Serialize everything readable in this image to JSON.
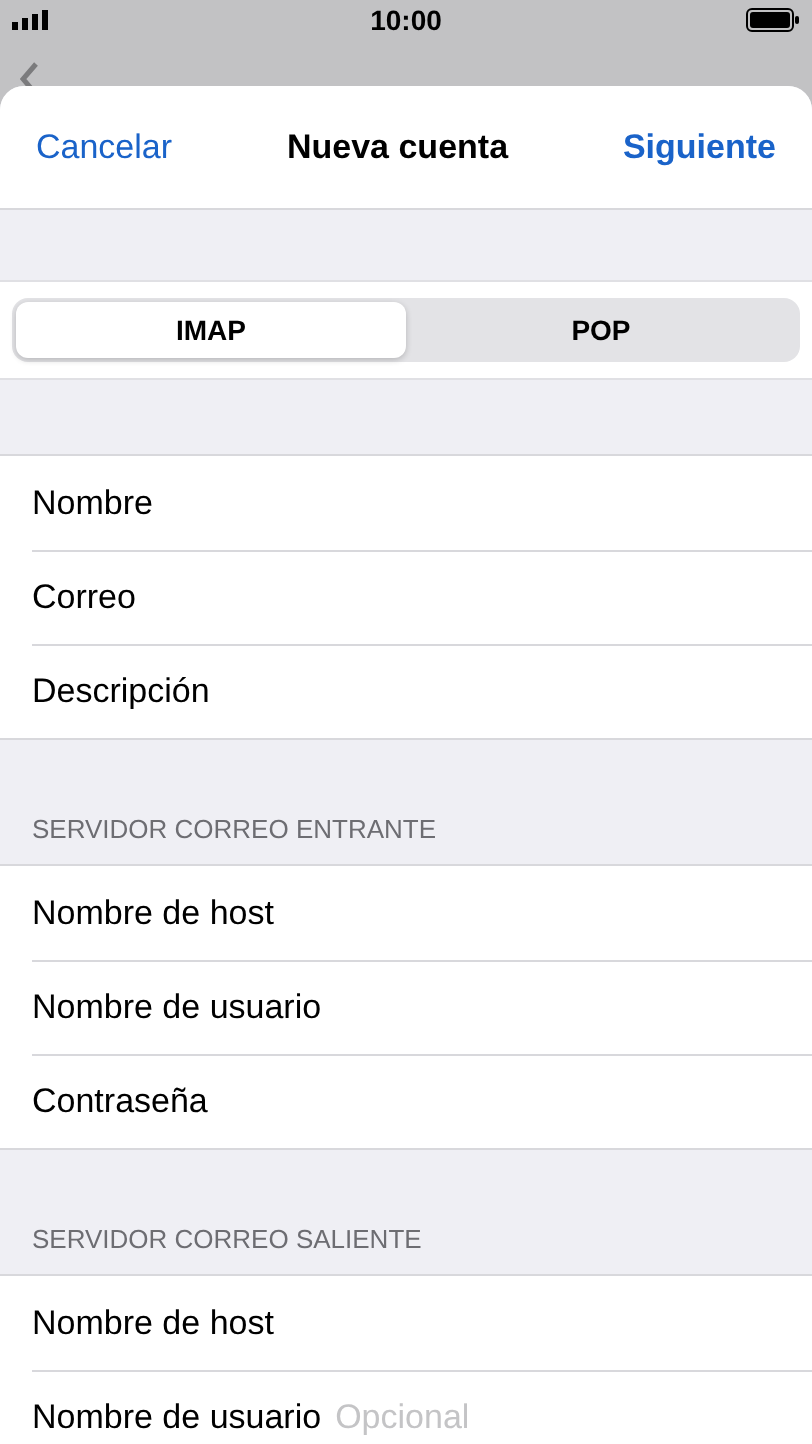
{
  "status_bar": {
    "time": "10:00"
  },
  "nav": {
    "cancel": "Cancelar",
    "title": "Nueva cuenta",
    "next": "Siguiente"
  },
  "segmented": [
    {
      "label": "IMAP",
      "selected": true
    },
    {
      "label": "POP",
      "selected": false
    }
  ],
  "sections": [
    {
      "fields": [
        {
          "label": "Nombre"
        },
        {
          "label": "Correo"
        },
        {
          "label": "Descripción"
        }
      ]
    },
    {
      "header": "SERVIDOR CORREO ENTRANTE",
      "fields": [
        {
          "label": "Nombre de host"
        },
        {
          "label": "Nombre de usuario"
        },
        {
          "label": "Contraseña"
        }
      ]
    },
    {
      "header": "SERVIDOR CORREO SALIENTE",
      "fields": [
        {
          "label": "Nombre de host"
        },
        {
          "label": "Nombre de usuario",
          "placeholder": "Opcional"
        }
      ]
    }
  ]
}
